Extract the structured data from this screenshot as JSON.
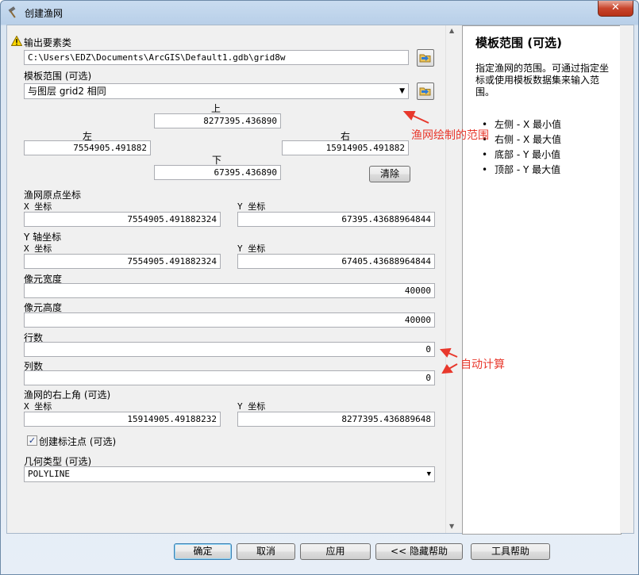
{
  "window": {
    "title": "创建渔网",
    "close_label": "✕"
  },
  "form": {
    "output_label": "输出要素类",
    "output_value": "C:\\Users\\EDZ\\Documents\\ArcGIS\\Default1.gdb\\grid8w",
    "template_label": "模板范围 (可选)",
    "template_value": "与图层 grid2 相同",
    "extent": {
      "top_label": "上",
      "top_value": "8277395.436890",
      "left_label": "左",
      "left_value": "7554905.491882",
      "right_label": "右",
      "right_value": "15914905.491882",
      "bottom_label": "下",
      "bottom_value": "67395.436890",
      "clear_label": "清除"
    },
    "origin": {
      "label": "渔网原点坐标",
      "x_label": "X 坐标",
      "x_value": "7554905.491882324",
      "y_label": "Y 坐标",
      "y_value": "67395.43688964844"
    },
    "yaxis": {
      "label": "Y 轴坐标",
      "x_label": "X 坐标",
      "x_value": "7554905.491882324",
      "y_label": "Y 坐标",
      "y_value": "67405.43688964844"
    },
    "cell_width": {
      "label": "像元宽度",
      "value": "40000"
    },
    "cell_height": {
      "label": "像元高度",
      "value": "40000"
    },
    "rows": {
      "label": "行数",
      "value": "0"
    },
    "cols": {
      "label": "列数",
      "value": "0"
    },
    "corner": {
      "label": "渔网的右上角 (可选)",
      "x_label": "X 坐标",
      "x_value": "15914905.49188232",
      "y_label": "Y 坐标",
      "y_value": "8277395.436889648"
    },
    "labels_checkbox": {
      "label": "创建标注点 (可选)",
      "checked": true
    },
    "geometry": {
      "label": "几何类型 (可选)",
      "value": "POLYLINE"
    }
  },
  "help": {
    "title": "模板范围 (可选)",
    "description": "指定渔网的范围。可通过指定坐标或使用模板数据集来输入范围。",
    "items": [
      "左侧 - X 最小值",
      "右侧 - X 最大值",
      "底部 - Y 最小值",
      "顶部 - Y 最大值"
    ]
  },
  "buttons": {
    "ok": "确定",
    "cancel": "取消",
    "apply": "应用",
    "hide_help": "<< 隐藏帮助",
    "tool_help": "工具帮助"
  },
  "annotations": {
    "extent_note": "渔网绘制的范围",
    "auto_note": "自动计算",
    "color": "#e8382c"
  }
}
